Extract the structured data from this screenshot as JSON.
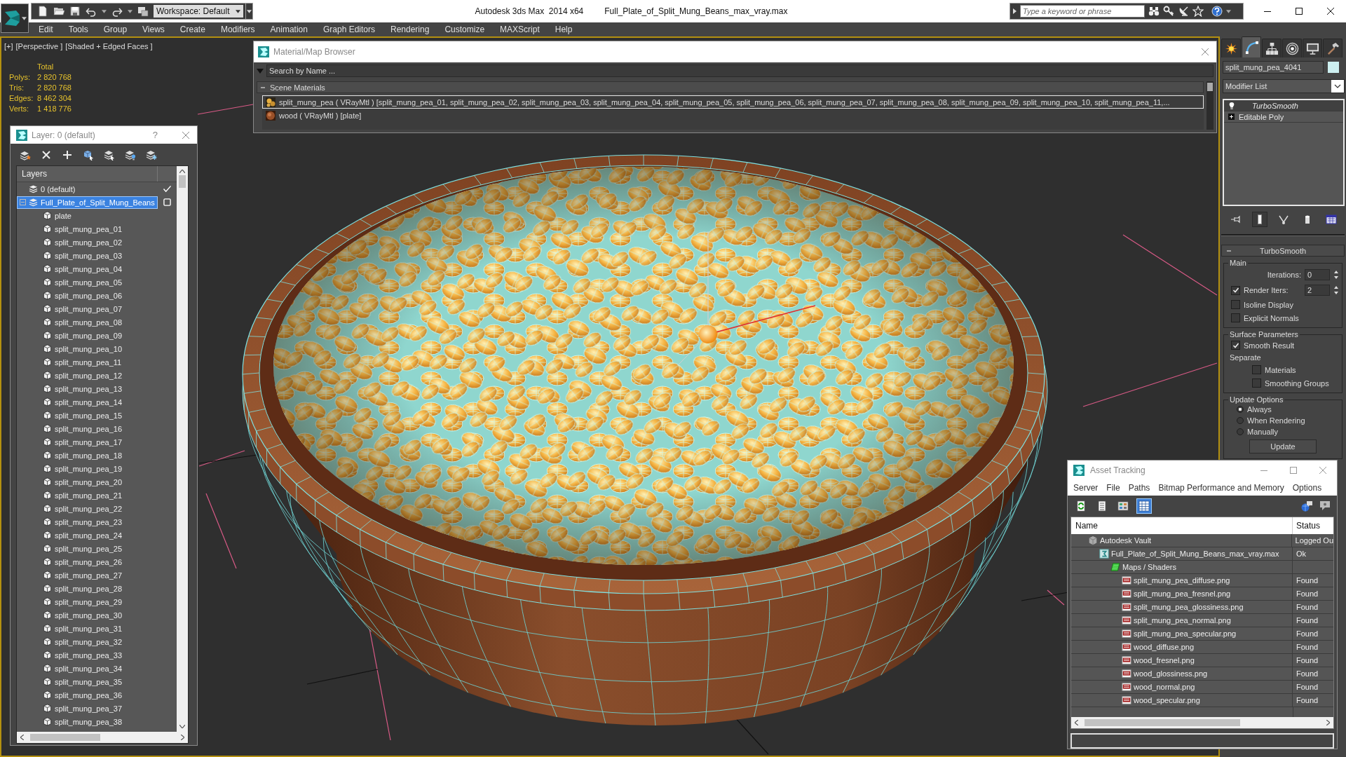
{
  "title_bar": {
    "workspace": "Workspace: Default",
    "app_title": "Autodesk 3ds Max  2014 x64",
    "file_name": "Full_Plate_of_Split_Mung_Beans_max_vray.max",
    "search": {
      "placeholder": "Type a keyword or phrase"
    }
  },
  "menu_bar": [
    "Edit",
    "Tools",
    "Group",
    "Views",
    "Create",
    "Modifiers",
    "Animation",
    "Graph Editors",
    "Rendering",
    "Customize",
    "MAXScript",
    "Help"
  ],
  "viewport": {
    "labels": [
      "[+]",
      "[Perspective ]",
      "[Shaded + Edged Faces ]"
    ],
    "stats": {
      "header": "Total",
      "rows": [
        {
          "label": "Polys:",
          "value": "2 820 768"
        },
        {
          "label": "Tris:",
          "value": "2 820 768"
        },
        {
          "label": "Edges:",
          "value": "8 462 304"
        },
        {
          "label": "Verts:",
          "value": "1 418 776"
        }
      ]
    }
  },
  "material_browser": {
    "title": "Material/Map Browser",
    "search": {
      "placeholder": "Search by Name ..."
    },
    "groups": [
      {
        "label": "Scene Materials",
        "expanded": true,
        "materials": [
          {
            "kind": "mung",
            "name": "split_mung_pea ( VRayMtl ) [split_mung_pea_01, split_mung_pea_02, split_mung_pea_03, split_mung_pea_04, split_mung_pea_05, split_mung_pea_06, split_mung_pea_07, split_mung_pea_08, split_mung_pea_09, split_mung_pea_10, split_mung_pea_11,...",
            "selected": true
          },
          {
            "kind": "wood",
            "name": "wood ( VRayMtl ) [plate]",
            "selected": false
          }
        ]
      }
    ]
  },
  "layer_dialog": {
    "title": "Layer: 0 (default)",
    "help": "?",
    "column": "Layers",
    "layers": [
      {
        "name": "0 (default)",
        "current": true,
        "selected": false
      },
      {
        "name": "Full_Plate_of_Split_Mung_Beans",
        "current": false,
        "selected": true,
        "expanded": true,
        "children": [
          {
            "name": "plate",
            "selected": false
          },
          {
            "name": "split_mung_pea_01",
            "selected": false
          },
          {
            "name": "split_mung_pea_02",
            "selected": false
          },
          {
            "name": "split_mung_pea_03",
            "selected": false
          },
          {
            "name": "split_mung_pea_04",
            "selected": false
          },
          {
            "name": "split_mung_pea_05",
            "selected": false
          },
          {
            "name": "split_mung_pea_06",
            "selected": false
          },
          {
            "name": "split_mung_pea_07",
            "selected": false
          },
          {
            "name": "split_mung_pea_08",
            "selected": false
          },
          {
            "name": "split_mung_pea_09",
            "selected": false
          },
          {
            "name": "split_mung_pea_10",
            "selected": false
          },
          {
            "name": "split_mung_pea_11",
            "selected": false
          },
          {
            "name": "split_mung_pea_12",
            "selected": false
          },
          {
            "name": "split_mung_pea_13",
            "selected": false
          },
          {
            "name": "split_mung_pea_14",
            "selected": false
          },
          {
            "name": "split_mung_pea_15",
            "selected": false
          },
          {
            "name": "split_mung_pea_16",
            "selected": false
          },
          {
            "name": "split_mung_pea_17",
            "selected": false
          },
          {
            "name": "split_mung_pea_18",
            "selected": false
          },
          {
            "name": "split_mung_pea_19",
            "selected": false
          },
          {
            "name": "split_mung_pea_20",
            "selected": false
          },
          {
            "name": "split_mung_pea_21",
            "selected": false
          },
          {
            "name": "split_mung_pea_22",
            "selected": false
          },
          {
            "name": "split_mung_pea_23",
            "selected": false
          },
          {
            "name": "split_mung_pea_24",
            "selected": false
          },
          {
            "name": "split_mung_pea_25",
            "selected": false
          },
          {
            "name": "split_mung_pea_26",
            "selected": false
          },
          {
            "name": "split_mung_pea_27",
            "selected": false
          },
          {
            "name": "split_mung_pea_28",
            "selected": false
          },
          {
            "name": "split_mung_pea_29",
            "selected": false
          },
          {
            "name": "split_mung_pea_30",
            "selected": false
          },
          {
            "name": "split_mung_pea_31",
            "selected": false
          },
          {
            "name": "split_mung_pea_32",
            "selected": false
          },
          {
            "name": "split_mung_pea_33",
            "selected": false
          },
          {
            "name": "split_mung_pea_34",
            "selected": false
          },
          {
            "name": "split_mung_pea_35",
            "selected": false
          },
          {
            "name": "split_mung_pea_36",
            "selected": false
          },
          {
            "name": "split_mung_pea_37",
            "selected": false
          },
          {
            "name": "split_mung_pea_38",
            "selected": false
          }
        ]
      }
    ]
  },
  "command_panel": {
    "tabs": [
      {
        "kind": "create",
        "selected": false
      },
      {
        "kind": "modify",
        "selected": true
      },
      {
        "kind": "hierarchy",
        "selected": false
      },
      {
        "kind": "motion",
        "selected": false
      },
      {
        "kind": "display",
        "selected": false
      },
      {
        "kind": "utilities",
        "selected": false
      }
    ],
    "object_name": "split_mung_pea_4041",
    "modifier_list": "Modifier List",
    "stack": [
      {
        "kind": "modifier",
        "name": "TurboSmooth",
        "enabled": true,
        "instanced": true,
        "selected": true
      },
      {
        "kind": "base",
        "name": "Editable Poly",
        "expanded": false,
        "instanced": false,
        "selected": false
      }
    ],
    "stack_tools": [
      {
        "kind": "pin",
        "on": false
      },
      {
        "kind": "end_result",
        "on": true
      },
      {
        "kind": "make_unique",
        "on": false
      },
      {
        "kind": "remove",
        "on": false
      },
      {
        "kind": "configure",
        "on": false
      }
    ],
    "rollout": {
      "title": "TurboSmooth",
      "expanded": true,
      "groups": [
        {
          "title": "Main",
          "controls": [
            {
              "kind": "spinner",
              "label": "Iterations:",
              "value": "0"
            },
            {
              "kind": "check_spinner",
              "label": "Render Iters:",
              "value": "2",
              "checked": true
            },
            {
              "kind": "checkbox",
              "label": "Isoline Display",
              "checked": false
            },
            {
              "kind": "checkbox",
              "label": "Explicit Normals",
              "checked": false
            }
          ]
        },
        {
          "title": "Surface Parameters",
          "controls": [
            {
              "kind": "checkbox",
              "label": "Smooth Result",
              "checked": true
            },
            {
              "kind": "label",
              "label": "Separate",
              "children": [
                {
                  "kind": "checkbox",
                  "label": "Materials",
                  "checked": false
                },
                {
                  "kind": "checkbox",
                  "label": "Smoothing Groups",
                  "checked": false
                }
              ]
            }
          ]
        },
        {
          "title": "Update Options",
          "controls": [
            {
              "kind": "radio",
              "label": "Always",
              "selected": true
            },
            {
              "kind": "radio",
              "label": "When Rendering",
              "selected": false
            },
            {
              "kind": "radio",
              "label": "Manually",
              "selected": false
            },
            {
              "kind": "button",
              "label": "Update"
            }
          ]
        }
      ]
    }
  },
  "asset_tracking": {
    "title": "Asset Tracking",
    "menu": [
      "Server",
      "File",
      "Paths",
      "Bitmap Performance and Memory",
      "Options"
    ],
    "views": [
      {
        "kind": "refresh",
        "selected": false
      },
      {
        "kind": "list",
        "selected": false
      },
      {
        "kind": "thumbnails",
        "selected": false
      },
      {
        "kind": "table",
        "selected": true
      }
    ],
    "columns": [
      "Name",
      "Status"
    ],
    "rows": [
      {
        "kind": "vault",
        "name": "Autodesk Vault",
        "status": "Logged Ou",
        "selected": false,
        "children": [
          {
            "kind": "scene",
            "name": "Full_Plate_of_Split_Mung_Beans_max_vray.max",
            "status": "Ok",
            "selected": false,
            "children": [
              {
                "kind": "folder",
                "name": "Maps / Shaders",
                "selected": false,
                "children": [
                  {
                    "kind": "png",
                    "name": "split_mung_pea_diffuse.png",
                    "status": "Found",
                    "selected": false
                  },
                  {
                    "kind": "png",
                    "name": "split_mung_pea_fresnel.png",
                    "status": "Found",
                    "selected": false
                  },
                  {
                    "kind": "png",
                    "name": "split_mung_pea_glossiness.png",
                    "status": "Found",
                    "selected": false
                  },
                  {
                    "kind": "png",
                    "name": "split_mung_pea_normal.png",
                    "status": "Found",
                    "selected": false
                  },
                  {
                    "kind": "png",
                    "name": "split_mung_pea_specular.png",
                    "status": "Found",
                    "selected": false
                  },
                  {
                    "kind": "png",
                    "name": "wood_diffuse.png",
                    "status": "Found",
                    "selected": false
                  },
                  {
                    "kind": "png",
                    "name": "wood_fresnel.png",
                    "status": "Found",
                    "selected": false
                  },
                  {
                    "kind": "png",
                    "name": "wood_glossiness.png",
                    "status": "Found",
                    "selected": false
                  },
                  {
                    "kind": "png",
                    "name": "wood_normal.png",
                    "status": "Found",
                    "selected": false
                  },
                  {
                    "kind": "png",
                    "name": "wood_specular.png",
                    "status": "Found",
                    "selected": false
                  }
                ]
              }
            ]
          }
        ]
      }
    ]
  }
}
